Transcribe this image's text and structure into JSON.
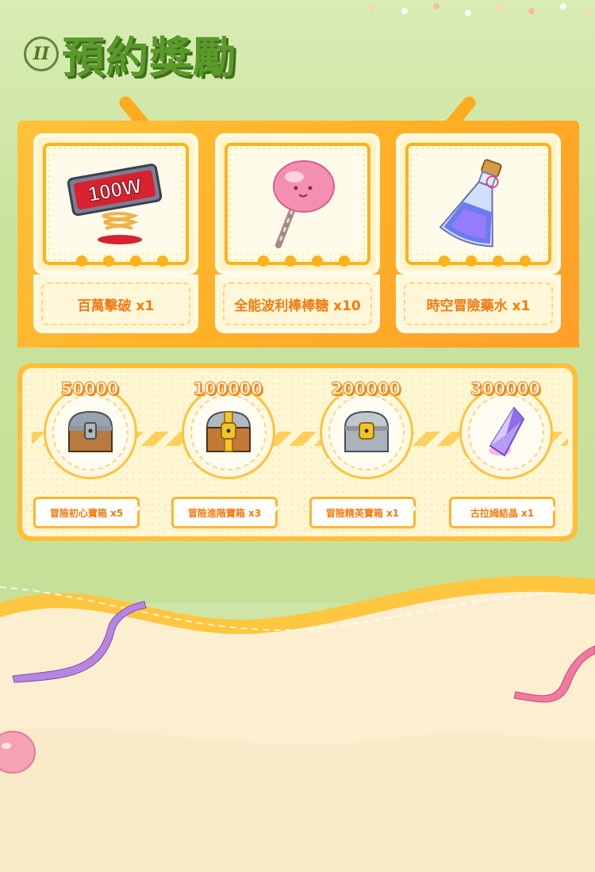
{
  "header": {
    "roman": "II",
    "title": "預約獎勵"
  },
  "rewards": [
    {
      "label": "百萬擊破 x1",
      "icon": "100w-sign-icon"
    },
    {
      "label": "全能波利棒棒糖 x10",
      "icon": "lollipop-icon"
    },
    {
      "label": "時空冒險藥水 x1",
      "icon": "potion-icon"
    }
  ],
  "milestones": [
    {
      "count": "50000",
      "label": "冒險初心寶箱 x5",
      "icon": "bronze-chest-icon"
    },
    {
      "count": "100000",
      "label": "冒險進階寶箱 x3",
      "icon": "gold-chest-icon"
    },
    {
      "count": "200000",
      "label": "冒險精英寶箱 x1",
      "icon": "silver-chest-icon"
    },
    {
      "count": "300000",
      "label": "古拉姆結晶 x1",
      "icon": "crystal-icon"
    }
  ],
  "colors": {
    "accent": "#ffb11a",
    "label_text": "#f47b12",
    "title_green": "#5a9a2a"
  }
}
